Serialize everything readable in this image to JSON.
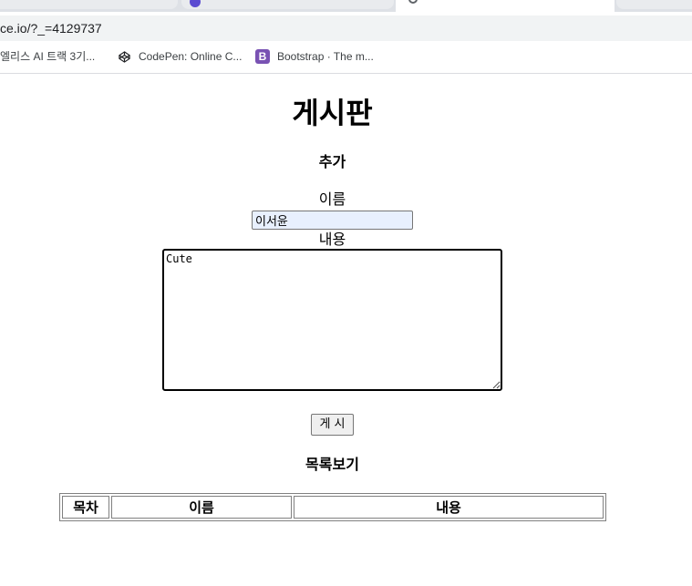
{
  "browser": {
    "tabs": [
      {
        "label": ""
      },
      {
        "label": ""
      },
      {
        "label": ""
      },
      {
        "label": ""
      }
    ],
    "address_bar": {
      "url": "ce.io/?_=4129737"
    },
    "bookmarks": [
      {
        "label": "엘리스 AI 트랙 3기...",
        "icon": "folder-icon"
      },
      {
        "label": "CodePen: Online C...",
        "icon": "codepen-icon"
      },
      {
        "label": "Bootstrap · The m...",
        "icon": "bootstrap-icon",
        "icon_glyph": "B"
      }
    ]
  },
  "page": {
    "title": "게시판",
    "add_section": {
      "heading": "추가",
      "name_label": "이름",
      "name_value": "이서윤",
      "content_label": "내용",
      "content_value": "Cute",
      "submit_label": "게 시"
    },
    "list_section": {
      "heading": "목록보기",
      "columns": [
        "목차",
        "이름",
        "내용"
      ],
      "rows": []
    }
  },
  "colors": {
    "input_autofill_bg": "#e8f0fe",
    "bootstrap_brand": "#7952b3"
  }
}
